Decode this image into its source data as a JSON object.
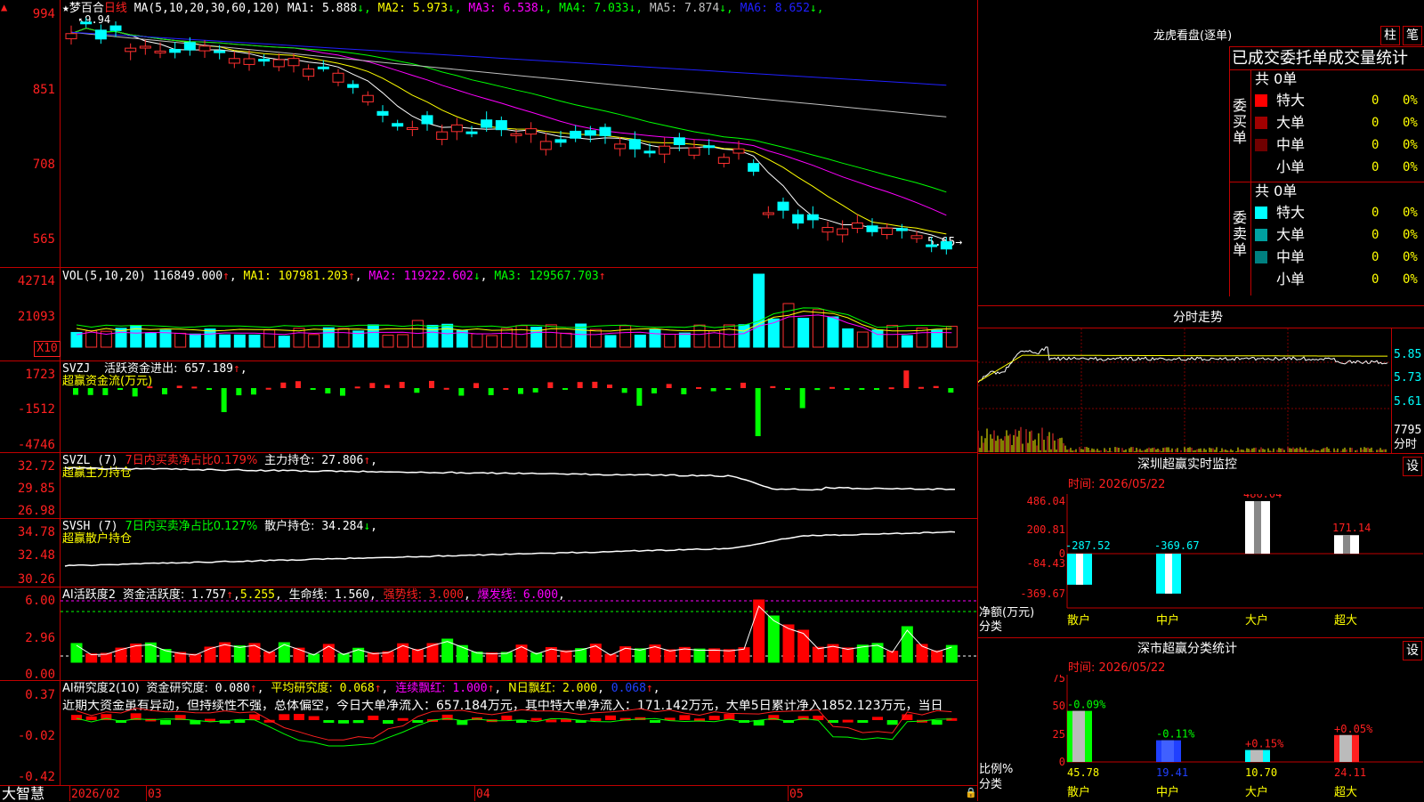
{
  "stock": {
    "name": "梦百合",
    "period": "日线",
    "star": "★",
    "marker_hi": "9.94",
    "marker_lo": "5.65"
  },
  "main": {
    "ma_label": "MA(5,10,20,30,60,120)",
    "ma": [
      {
        "name": "MA1:",
        "value": "5.888",
        "arrow": "↓",
        "color": "#ffffff"
      },
      {
        "name": "MA2:",
        "value": "5.973",
        "arrow": "↓",
        "color": "#ffff00"
      },
      {
        "name": "MA3:",
        "value": "6.538",
        "arrow": "↓",
        "color": "#ff00ff"
      },
      {
        "name": "MA4:",
        "value": "7.033",
        "arrow": "↓",
        "color": "#00ff00"
      },
      {
        "name": "MA5:",
        "value": "7.874",
        "arrow": "↓",
        "color": "#c0c0c0"
      },
      {
        "name": "MA6:",
        "value": "8.652",
        "arrow": "↓",
        "color": "#2020ff"
      }
    ],
    "yaxis": [
      "994",
      "851",
      "708",
      "565"
    ]
  },
  "vol": {
    "label": "VOL(5,10,20)",
    "value": "116849.000",
    "arrow": "↑",
    "ma": [
      {
        "name": "MA1:",
        "value": "107981.203",
        "arrow": "↑"
      },
      {
        "name": "MA2:",
        "value": "119222.602",
        "arrow": "↓"
      },
      {
        "name": "MA3:",
        "value": "129567.703",
        "arrow": "↑"
      }
    ],
    "yaxis": [
      "42714",
      "21093"
    ],
    "unit": "X10"
  },
  "svzj": {
    "label": "SVZJ",
    "active_label": "活跃资金进出:",
    "active_value": "657.189",
    "arrow": "↑",
    "sub": "超赢资金流(万元)",
    "yaxis": [
      "1723",
      "-1512",
      "-4746"
    ]
  },
  "svzl": {
    "label": "SVZL (7)",
    "text1": "7日内买卖净占比0.179%",
    "text2": "主力持仓:",
    "value": "27.806",
    "arrow": "↑",
    "sub": "超赢主力持仓",
    "yaxis": [
      "32.72",
      "29.85",
      "26.98"
    ]
  },
  "svsh": {
    "label": "SVSH (7)",
    "text1": "7日内买卖净占比0.127%",
    "text2": "散户持仓:",
    "value": "34.284",
    "arrow": "↓",
    "sub": "超赢散户持仓",
    "yaxis": [
      "34.78",
      "32.48",
      "30.26"
    ]
  },
  "ai1": {
    "label": "AI活跃度2",
    "t1": "资金活跃度:",
    "v1": "1.757",
    "v2": "5.255",
    "t3": "生命线:",
    "v3": "1.560",
    "t4": "强势线:",
    "v4": "3.000",
    "t5": "爆发线:",
    "v5": "6.000",
    "yaxis": [
      "6.00",
      "2.96",
      "0.00"
    ]
  },
  "ai2": {
    "label": "AI研究度2(10)",
    "t1": "资金研究度:",
    "v1": "0.080",
    "t2": "平均研究度:",
    "v2": "0.068",
    "t3": "连续飘红:",
    "v3": "1.000",
    "t4": "N日飘红:",
    "v4": "2.000",
    "v5": "0.068",
    "comment": "近期大资金虽有异动，但持续性不强，总体偏空，今日大单净流入：657.184万元，其中特大单净流入：171.142万元，大单5日累计净入1852.123万元，当日",
    "yaxis": [
      "0.37",
      "-0.02",
      "-0.42"
    ]
  },
  "bottom": {
    "brand": "大智慧",
    "dates": [
      "2026/02",
      "03",
      "04",
      "05"
    ]
  },
  "lhb": {
    "title": "龙虎看盘(逐单)",
    "tabs": [
      "柱",
      "笔"
    ],
    "subtitle": "已成交委托单成交量统计",
    "buy": {
      "side": "委买单",
      "total": "共 0单",
      "rows": [
        {
          "label": "特大",
          "count": "0",
          "pct": "0%",
          "color": "#ff0000"
        },
        {
          "label": "大单",
          "count": "0",
          "pct": "0%",
          "color": "#a00000"
        },
        {
          "label": "中单",
          "count": "0",
          "pct": "0%",
          "color": "#700000"
        },
        {
          "label": "小单",
          "count": "0",
          "pct": "0%",
          "color": "#000000"
        }
      ]
    },
    "sell": {
      "side": "委卖单",
      "total": "共 0单",
      "rows": [
        {
          "label": "特大",
          "count": "0",
          "pct": "0%",
          "color": "#00ffff"
        },
        {
          "label": "大单",
          "count": "0",
          "pct": "0%",
          "color": "#00a0a0"
        },
        {
          "label": "中单",
          "count": "0",
          "pct": "0%",
          "color": "#008080"
        },
        {
          "label": "小单",
          "count": "0",
          "pct": "0%",
          "color": "#000000"
        }
      ]
    }
  },
  "intraday": {
    "title": "分时走势",
    "yaxis": [
      "5.85",
      "5.73",
      "5.61"
    ],
    "vol": "7795",
    "vol_label": "分时"
  },
  "monitor": {
    "title": "深圳超赢实时监控",
    "set": "设",
    "time": "时间: 2026/05/22",
    "ylabel": "净额(万元)",
    "xlabel": "分类",
    "yaxis": [
      "486.04",
      "200.81",
      "0",
      "-84.43",
      "-369.67"
    ],
    "bars": [
      {
        "name": "散户",
        "value": "-287.52"
      },
      {
        "name": "中户",
        "value": "-369.67"
      },
      {
        "name": "大户",
        "value": "486.04"
      },
      {
        "name": "超大",
        "value": "171.14"
      }
    ]
  },
  "classify": {
    "title": "深市超赢分类统计",
    "set": "设",
    "time": "时间: 2026/05/22",
    "ylabel": "比例%",
    "xlabel": "分类",
    "yaxis": [
      "75",
      "50",
      "25",
      "0"
    ],
    "bars": [
      {
        "name": "散户",
        "value": "45.78",
        "delta": "-0.09%"
      },
      {
        "name": "中户",
        "value": "19.41",
        "delta": "-0.11%"
      },
      {
        "name": "大户",
        "value": "10.70",
        "delta": "+0.15%"
      },
      {
        "name": "超大",
        "value": "24.11",
        "delta": "+0.05%"
      }
    ]
  }
}
